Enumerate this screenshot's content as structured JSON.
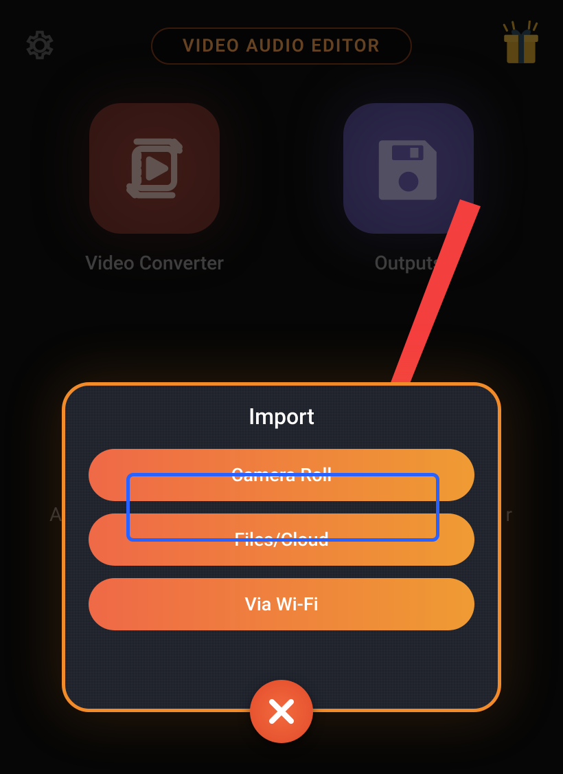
{
  "header": {
    "title": "VIDEO AUDIO EDITOR"
  },
  "tiles": {
    "video_converter": "Video Converter",
    "outputs": "Outputs"
  },
  "import_sheet": {
    "title": "Import",
    "options": {
      "camera_roll": "Camera Roll",
      "files_cloud": "Files/Cloud",
      "via_wifi": "Via Wi-Fi"
    }
  },
  "bg_text": {
    "left": "A",
    "right": "r"
  },
  "icons": {
    "settings": "gear-icon",
    "gift": "gift-icon",
    "close": "close-icon",
    "converter": "video-convert-icon",
    "disk": "save-disk-icon"
  },
  "colors": {
    "accent_orange": "#f28b2a",
    "highlight_blue": "#2a62ff",
    "arrow_red": "#f43f3f"
  }
}
